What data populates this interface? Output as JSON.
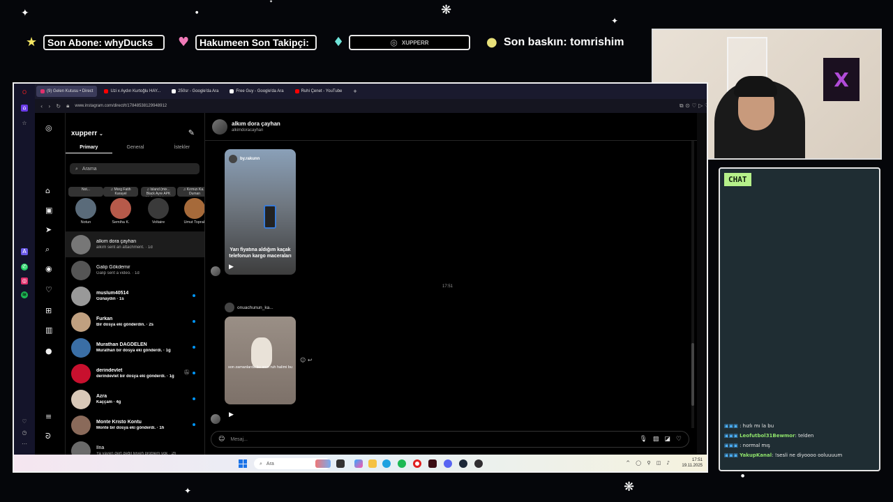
{
  "overlay": {
    "last_sub": "Son Abone: whyDucks",
    "last_follower": "Hakumeen    Son Takipçi: ",
    "instagram_handle": "XUPPERR",
    "last_raid": "Son baskın: tomrishim",
    "icon_star": "star-icon",
    "icon_heart": "heart-icon",
    "icon_gem": "gem-icon",
    "icon_coin": "coin-icon"
  },
  "stream_chat": {
    "title": "CHAT",
    "messages": [
      {
        "user": "",
        "text": ": hızlı mı la bu",
        "color": "#e0314f"
      },
      {
        "user": "Leofutbol31Bewmor",
        "text": ": telden",
        "color": "#8fe36b"
      },
      {
        "user": "",
        "text": ": normal mış",
        "color": "#e0314f"
      },
      {
        "user": "YakupKanal",
        "text": ": !sesli ne diyoooo ooluuuum",
        "color": "#8fe36b"
      }
    ]
  },
  "browser": {
    "tabs": [
      {
        "label": "(9) Gelen Kutusu • Direct",
        "active": true,
        "color": "#e1306c"
      },
      {
        "label": "Uzi x Aydın Kurtoğlu HAY...",
        "active": false,
        "color": "#ff0000"
      },
      {
        "label": "250sr - Google'da Ara",
        "active": false,
        "color": "#ffffff"
      },
      {
        "label": "Free Guy - Google'da Ara",
        "active": false,
        "color": "#ffffff"
      },
      {
        "label": "Ruhi Çenet - YouTube",
        "active": false,
        "color": "#ff0000"
      }
    ],
    "new_tab": "+",
    "url": "www.instagram.com/direct/t/17848538129948912"
  },
  "instagram": {
    "account": "xupperr",
    "tabs": [
      "Primary",
      "General",
      "İstekler"
    ],
    "search_placeholder": "Arama",
    "stories": [
      {
        "note": "Not...",
        "name": "Notun",
        "color": "#5a6b7a"
      },
      {
        "note": "♫ Morg Fatih Karayel",
        "name": "Semiha K.",
        "color": "#b65a4a"
      },
      {
        "note": "♫ Island (mix... Black Ayre APK Herkese iyi ge...",
        "name": "Voltaire",
        "color": "#3a3a3a"
      },
      {
        "note": "♫ Kırmızı Ka... Duman",
        "name": "Umut Toprak",
        "color": "#a66a3a"
      }
    ],
    "conversations": [
      {
        "name": "alkım dora çayhan",
        "preview": "alkım sent an attachment. · 1d",
        "unread": false,
        "selected": true,
        "color": "#777777"
      },
      {
        "name": "Galip Gökdemir",
        "preview": "Galip sent a video. · 1d",
        "unread": false,
        "selected": false,
        "color": "#555555"
      },
      {
        "name": "muslum40514",
        "preview": "Günaydın · 1s",
        "unread": true,
        "selected": false,
        "color": "#999999"
      },
      {
        "name": "Furkan",
        "preview": "Bir dosya eki gönderdin. · 2s",
        "unread": true,
        "selected": false,
        "color": "#c0a080"
      },
      {
        "name": "Murathan DAĞDELEN",
        "preview": "Murathan bir dosya eki gönderdi. · 1g",
        "unread": true,
        "selected": false,
        "color": "#3a6ea5"
      },
      {
        "name": "derindevlet",
        "preview": "derindevlet bir dosya eki gönderdi. · 1g",
        "unread": true,
        "selected": false,
        "color": "#c8102e",
        "muted": true
      },
      {
        "name": "Azra",
        "preview": "Kaççam · 4g",
        "unread": true,
        "selected": false,
        "color": "#d8c8b8"
      },
      {
        "name": "Monte Kristo Kontu",
        "preview": "Monte bir dosya eki gönderdi. · 1h",
        "unread": true,
        "selected": false,
        "color": "#8a6a5a"
      },
      {
        "name": "İlna",
        "preview": "Ya vaven dert değil lyiyeh problem yok · 2h",
        "unread": false,
        "selected": false,
        "color": "#6a6a6a"
      }
    ],
    "chat": {
      "name": "alkım dora çayhan",
      "username": "alkimdoracayhan",
      "reel1_author": "by.rakunn",
      "reel1_caption": "Yarı fiyatına aldığım kaçak telefonun kargo maceraları",
      "timestamp": "17:51",
      "reel2_sender": "onuachunun_ka...",
      "reel2_caption": "son zamanlarda bu anın ruh halimi bu",
      "composer_placeholder": "Mesaj..."
    }
  },
  "taskbar": {
    "search_placeholder": "Ara",
    "time": "17:51",
    "date": "19.11.2025"
  }
}
